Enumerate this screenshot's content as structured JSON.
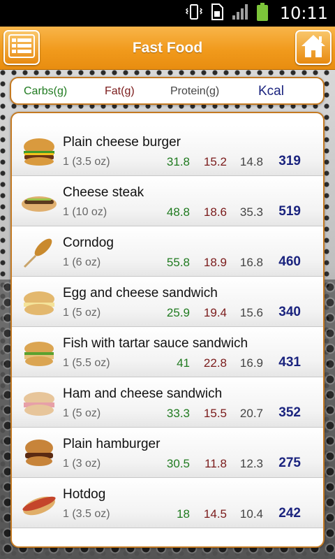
{
  "status_bar": {
    "time": "10:11",
    "icons": [
      "vibrate-icon",
      "sim-icon",
      "signal-icon",
      "battery-icon"
    ]
  },
  "header": {
    "title": "Fast Food",
    "accent_color": "#f19a1c",
    "menu_icon": "list-icon",
    "home_icon": "home-icon"
  },
  "columns": {
    "carbs": "Carbs(g)",
    "fat": "Fat(g)",
    "protein": "Protein(g)",
    "kcal": "Kcal"
  },
  "foods": [
    {
      "name": "Plain cheese burger",
      "serving": "1 (3.5 oz)",
      "carbs": "31.8",
      "fat": "15.2",
      "protein": "14.8",
      "kcal": "319",
      "icon": "cheeseburger-icon"
    },
    {
      "name": "Cheese steak",
      "serving": "1 (10 oz)",
      "carbs": "48.8",
      "fat": "18.6",
      "protein": "35.3",
      "kcal": "519",
      "icon": "cheesesteak-icon"
    },
    {
      "name": "Corndog",
      "serving": "1 (6 oz)",
      "carbs": "55.8",
      "fat": "18.9",
      "protein": "16.8",
      "kcal": "460",
      "icon": "corndog-icon"
    },
    {
      "name": "Egg and cheese sandwich",
      "serving": "1 (5 oz)",
      "carbs": "25.9",
      "fat": "19.4",
      "protein": "15.6",
      "kcal": "340",
      "icon": "egg-sandwich-icon"
    },
    {
      "name": "Fish with tartar sauce sandwich",
      "serving": "1 (5.5 oz)",
      "carbs": "41",
      "fat": "22.8",
      "protein": "16.9",
      "kcal": "431",
      "icon": "fish-sandwich-icon"
    },
    {
      "name": "Ham and cheese sandwich",
      "serving": "1 (5 oz)",
      "carbs": "33.3",
      "fat": "15.5",
      "protein": "20.7",
      "kcal": "352",
      "icon": "ham-sandwich-icon"
    },
    {
      "name": "Plain hamburger",
      "serving": "1 (3 oz)",
      "carbs": "30.5",
      "fat": "11.8",
      "protein": "12.3",
      "kcal": "275",
      "icon": "hamburger-icon"
    },
    {
      "name": "Hotdog",
      "serving": "1 (3.5 oz)",
      "carbs": "18",
      "fat": "14.5",
      "protein": "10.4",
      "kcal": "242",
      "icon": "hotdog-icon"
    }
  ]
}
